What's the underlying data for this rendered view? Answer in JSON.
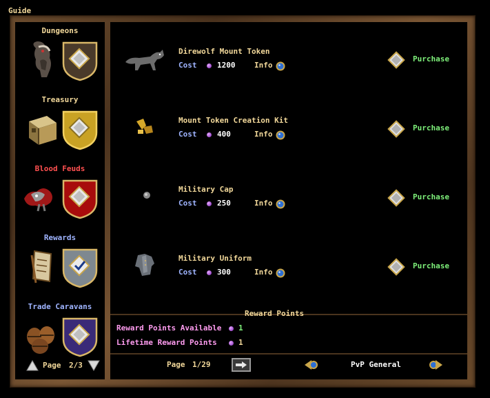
{
  "guide": {
    "label": "Guide"
  },
  "sidebar": {
    "categories": [
      {
        "title": "Dungeons",
        "color": "#f2d89a"
      },
      {
        "title": "Treasury",
        "color": "#f2d89a"
      },
      {
        "title": "Blood Feuds",
        "color": "#ff5050"
      },
      {
        "title": "Rewards",
        "color": "#9fb4ff"
      },
      {
        "title": "Trade Caravans",
        "color": "#9fb4ff"
      }
    ],
    "page_label": "Page",
    "page_value": "2/3"
  },
  "items": [
    {
      "name": "Direwolf Mount Token",
      "cost_label": "Cost",
      "cost": "1200",
      "info_label": "Info",
      "purchase_label": "Purchase"
    },
    {
      "name": "Mount Token Creation Kit",
      "cost_label": "Cost",
      "cost": "400",
      "info_label": "Info",
      "purchase_label": "Purchase"
    },
    {
      "name": "Military Cap",
      "cost_label": "Cost",
      "cost": "250",
      "info_label": "Info",
      "purchase_label": "Purchase"
    },
    {
      "name": "Military Uniform",
      "cost_label": "Cost",
      "cost": "300",
      "info_label": "Info",
      "purchase_label": "Purchase"
    }
  ],
  "reward_points": {
    "title": "Reward Points",
    "available_label": "Reward Points Available",
    "available_value": "1",
    "lifetime_label": "Lifetime Reward Points",
    "lifetime_value": "1"
  },
  "footer": {
    "page_label": "Page",
    "page_value": "1/29",
    "category_label": "PvP General"
  },
  "colors": {
    "gold_text": "#f2d89a",
    "purchase_green": "#7ef07a",
    "cost_blue": "#9fb4ff",
    "reward_pink": "#ff9cf0"
  }
}
